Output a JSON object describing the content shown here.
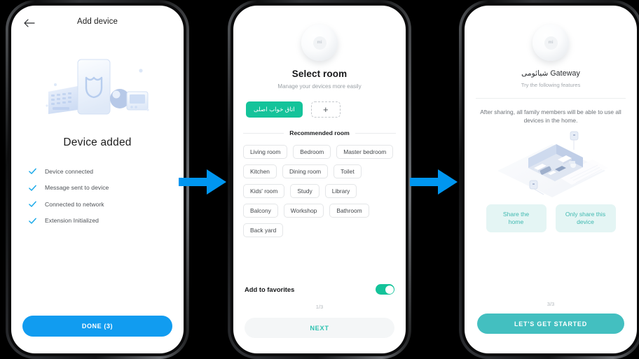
{
  "theme": {
    "arrow_color": "#0096F0",
    "blue_button": "#119CF0",
    "teal_accent": "#14C39A",
    "teal_button": "#43BFC0",
    "share_chip_bg": "#E4F5F4",
    "page_background": "#000000"
  },
  "screen1": {
    "nav_title": "Add device",
    "back_icon": "arrow-left-icon",
    "illustration": "devices-illustration",
    "heading": "Device added",
    "checklist": [
      {
        "label": "Device connected",
        "icon": "check-icon"
      },
      {
        "label": "Message sent to device",
        "icon": "check-icon"
      },
      {
        "label": "Connected to network",
        "icon": "check-icon"
      },
      {
        "label": "Extension Initialized",
        "icon": "check-icon"
      }
    ],
    "done_button": "DONE (3)"
  },
  "screen2": {
    "device_icon": "mi-gateway-puck-icon",
    "device_logo_text": "mi",
    "heading": "Select room",
    "subheading": "Manage your devices more easily",
    "selected_room": "اتاق خواب اصلی",
    "add_room_icon": "plus-icon",
    "section_label": "Recommended room",
    "rooms": [
      "Living room",
      "Bedroom",
      "Master bedroom",
      "Kitchen",
      "Dining room",
      "Toilet",
      "Kids' room",
      "Study",
      "Library",
      "Balcony",
      "Workshop",
      "Bathroom",
      "Back yard"
    ],
    "favorites_label": "Add to favorites",
    "favorites_toggle_state": "on",
    "pager": "1/3",
    "next_button": "NEXT"
  },
  "screen3": {
    "device_icon": "mi-gateway-puck-icon",
    "device_logo_text": "mi",
    "heading": "شیائومی Gateway",
    "subheading": "Try the following features",
    "description": "After sharing, all family members will be able to use all devices in the home.",
    "illustration": "isometric-smart-home-illustration",
    "share_buttons": [
      {
        "line1": "Share the",
        "line2": "home"
      },
      {
        "line1": "Only share this",
        "line2": "device"
      }
    ],
    "pager": "3/3",
    "primary_button": "LET'S GET STARTED"
  },
  "arrows": [
    {
      "name": "flow-arrow-1",
      "direction": "right"
    },
    {
      "name": "flow-arrow-2",
      "direction": "right"
    }
  ]
}
